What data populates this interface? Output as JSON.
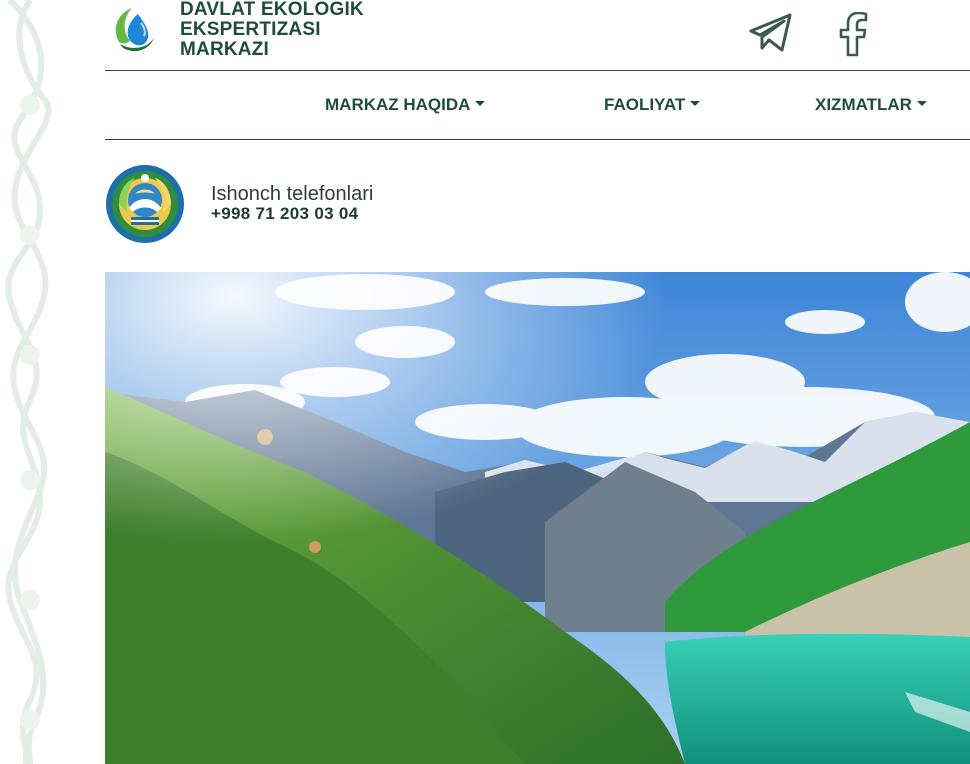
{
  "header": {
    "logo_lines": [
      "DAVLAT EKOLOGIK",
      "EKSPERTIZASI",
      "MARKAZI"
    ],
    "social": [
      {
        "name": "telegram",
        "icon": "telegram-icon"
      },
      {
        "name": "facebook",
        "icon": "facebook-icon"
      }
    ]
  },
  "nav": {
    "items": [
      {
        "label": "MARKAZ HAQIDA"
      },
      {
        "label": "FAOLIYAT"
      },
      {
        "label": "XIZMATLAR"
      }
    ]
  },
  "hotline": {
    "title": "Ishonch telefonlari",
    "phone": "+998 71 203 03 04"
  },
  "hero": {
    "icon": "mountain-lake-banner"
  },
  "colors": {
    "brand": "#1f4d3a",
    "ornament": "#e7efea",
    "sky": "#5b9be0",
    "lake": "#1fb8a0"
  }
}
